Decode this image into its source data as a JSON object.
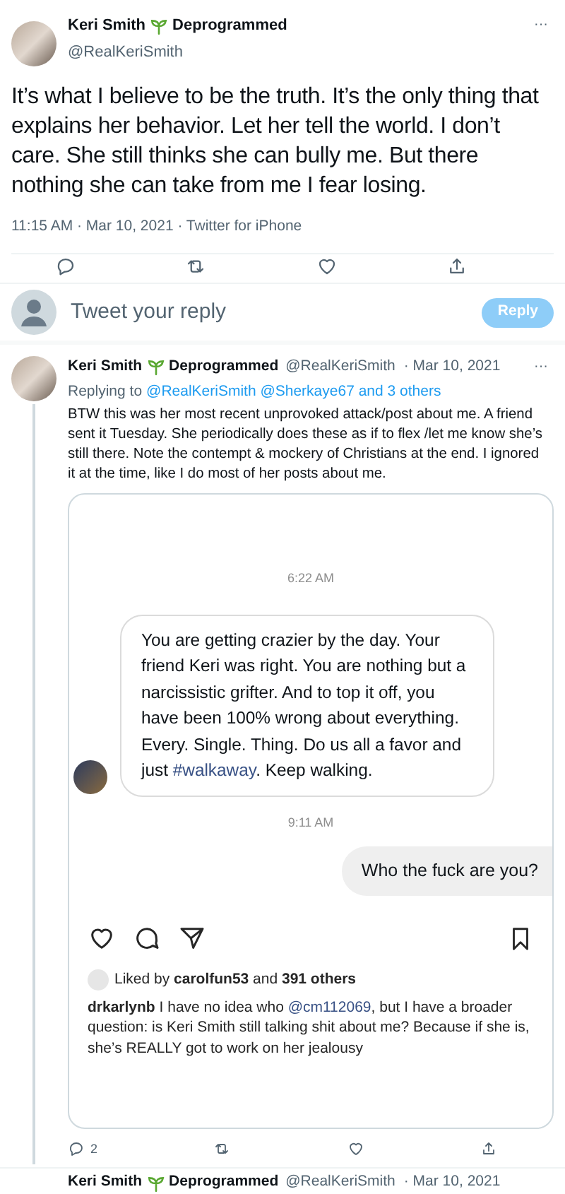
{
  "tweet": {
    "author": {
      "name": "Keri Smith",
      "badge": "Deprogrammed",
      "handle": "@RealKeriSmith"
    },
    "menu": "···",
    "text": "It’s what I believe to be the truth. It’s the only thing that explains her behavior. Let her tell the world. I don’t care. She still thinks she can bully me. But there nothing she can take from me I fear losing.",
    "meta": "11:15 AM · Mar 10, 2021 · Twitter for iPhone"
  },
  "reply_box": {
    "placeholder": "Tweet your reply",
    "button": {
      "label": "Reply",
      "disabled": true
    }
  },
  "reply": {
    "author": {
      "name": "Keri Smith",
      "badge": "Deprogrammed",
      "handle": "@RealKeriSmith",
      "date": "· Mar 10, 2021"
    },
    "menu": "···",
    "replying_label": "Replying to",
    "recipients": "@RealKeriSmith @Sherkaye67 and 3 others",
    "text": "BTW this was her most recent unprovoked attack/post about me. A friend sent it Tuesday. She periodically does these as if to flex /let me know she’s still there. Note the contempt & mockery of Christians at the end. I ignored it at the time, like I do most of her posts about me.",
    "screenshot": {
      "time_1": "6:22 AM",
      "received": {
        "before": "You are getting crazier by the day. Your friend Keri was right. You are nothing but a narcissistic grifter. And to top it off, you have been 100% wrong about everything. Every. Single. Thing. Do us all a favor and just ",
        "hashtag": "#walkaway",
        "after": ". Keep walking."
      },
      "time_2": "9:11 AM",
      "sent": "Who the fuck are you?",
      "likes": "Liked by **carolfun53** and **391 others**",
      "comment": {
        "user": "drkarlynb",
        "before": " I have no idea who ",
        "mention": "@cm112069",
        "after": ", but I have a broader question: is Keri Smith still talking shit about me? Because if she is, she’s REALLY got to work on her jealousy"
      }
    },
    "stats": {
      "replies": "2"
    }
  },
  "next_tweet": {
    "author": {
      "name": "Keri Smith",
      "badge": "Deprogrammed",
      "handle": "@RealKeriSmith",
      "date": "· Mar 10, 2021"
    }
  }
}
